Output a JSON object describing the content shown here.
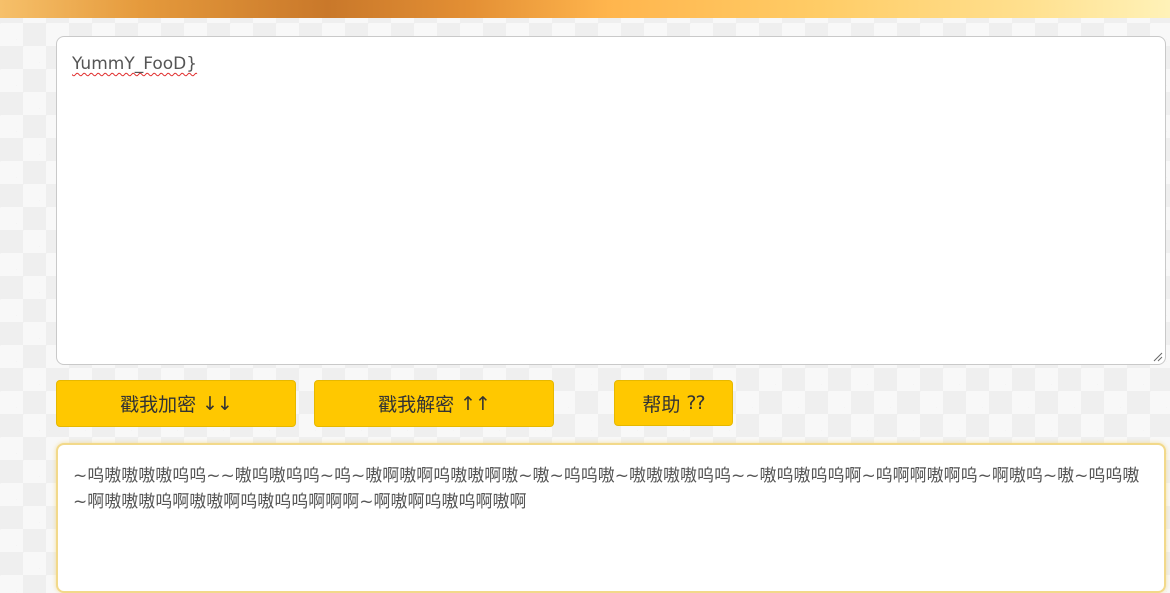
{
  "input": {
    "text": "YummY_FooD}"
  },
  "buttons": {
    "encrypt_label": "戳我加密",
    "encrypt_icon": "↓↓",
    "decrypt_label": "戳我解密",
    "decrypt_icon": "↑↑",
    "help_label": "帮助",
    "help_icon": "??"
  },
  "output": {
    "text": "~呜嗷嗷嗷嗷呜呜~~嗷呜嗷呜呜~呜~嗷啊嗷啊呜嗷嗷啊嗷~嗷~呜呜嗷~嗷嗷嗷嗷呜呜~~嗷呜嗷呜呜啊~呜啊啊嗷啊呜~啊嗷呜~嗷~呜呜嗷~啊嗷嗷嗷呜啊嗷嗷啊呜嗷呜呜啊啊啊~啊嗷啊呜嗷呜啊嗷啊"
  }
}
